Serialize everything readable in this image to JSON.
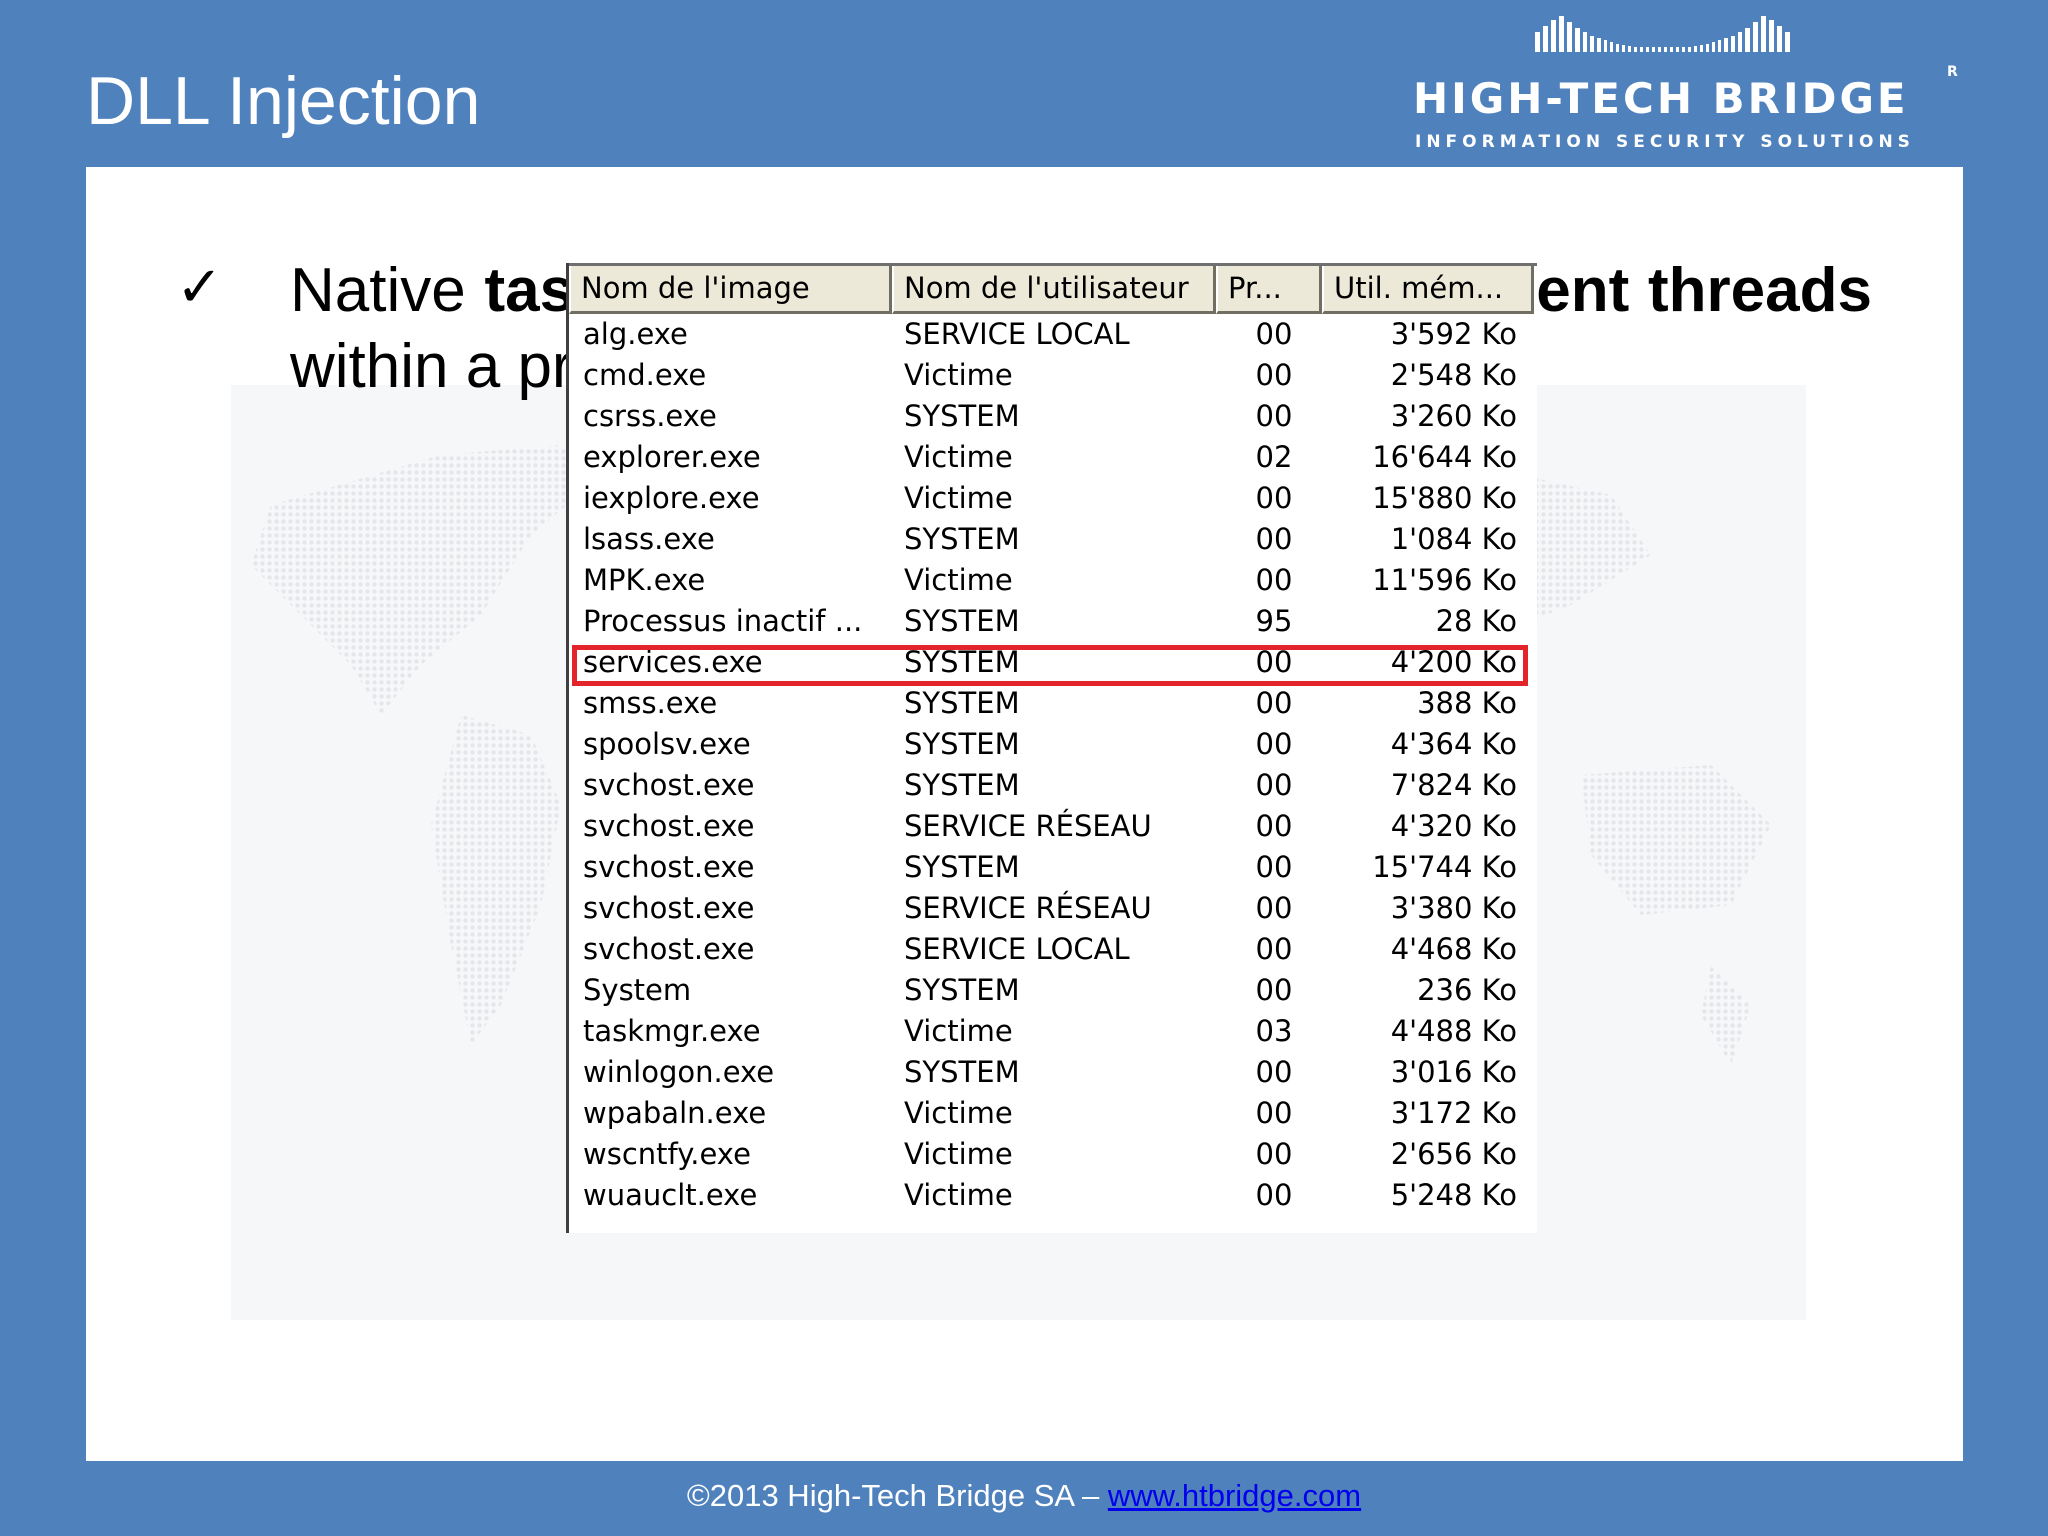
{
  "slide": {
    "title": "DLL Injection"
  },
  "logo": {
    "name": "HIGH-TECH BRIDGE",
    "tagline": "INFORMATION SECURITY SOLUTIONS",
    "registered_mark": "R"
  },
  "bullet": {
    "check_icon": "✓",
    "text_parts": {
      "p1": "Native ",
      "b1": "task manager does not display current threads",
      "p2": " within a process."
    }
  },
  "task_manager": {
    "columns": [
      {
        "label": "Nom de l'image"
      },
      {
        "label": "Nom de l'utilisateur"
      },
      {
        "label": "Pr..."
      },
      {
        "label": "Util. mém..."
      }
    ],
    "rows": [
      {
        "image": "alg.exe",
        "user": "SERVICE LOCAL",
        "cpu": "00",
        "mem": "3'592 Ko"
      },
      {
        "image": "cmd.exe",
        "user": "Victime",
        "cpu": "00",
        "mem": "2'548 Ko"
      },
      {
        "image": "csrss.exe",
        "user": "SYSTEM",
        "cpu": "00",
        "mem": "3'260 Ko"
      },
      {
        "image": "explorer.exe",
        "user": "Victime",
        "cpu": "02",
        "mem": "16'644 Ko"
      },
      {
        "image": "iexplore.exe",
        "user": "Victime",
        "cpu": "00",
        "mem": "15'880 Ko"
      },
      {
        "image": "lsass.exe",
        "user": "SYSTEM",
        "cpu": "00",
        "mem": "1'084 Ko"
      },
      {
        "image": "MPK.exe",
        "user": "Victime",
        "cpu": "00",
        "mem": "11'596 Ko"
      },
      {
        "image": "Processus inactif ...",
        "user": "SYSTEM",
        "cpu": "95",
        "mem": "28 Ko"
      },
      {
        "image": "services.exe",
        "user": "SYSTEM",
        "cpu": "00",
        "mem": "4'200 Ko"
      },
      {
        "image": "smss.exe",
        "user": "SYSTEM",
        "cpu": "00",
        "mem": "388 Ko"
      },
      {
        "image": "spoolsv.exe",
        "user": "SYSTEM",
        "cpu": "00",
        "mem": "4'364 Ko"
      },
      {
        "image": "svchost.exe",
        "user": "SYSTEM",
        "cpu": "00",
        "mem": "7'824 Ko"
      },
      {
        "image": "svchost.exe",
        "user": "SERVICE RÉSEAU",
        "cpu": "00",
        "mem": "4'320 Ko"
      },
      {
        "image": "svchost.exe",
        "user": "SYSTEM",
        "cpu": "00",
        "mem": "15'744 Ko"
      },
      {
        "image": "svchost.exe",
        "user": "SERVICE RÉSEAU",
        "cpu": "00",
        "mem": "3'380 Ko"
      },
      {
        "image": "svchost.exe",
        "user": "SERVICE LOCAL",
        "cpu": "00",
        "mem": "4'468 Ko"
      },
      {
        "image": "System",
        "user": "SYSTEM",
        "cpu": "00",
        "mem": "236 Ko"
      },
      {
        "image": "taskmgr.exe",
        "user": "Victime",
        "cpu": "03",
        "mem": "4'488 Ko"
      },
      {
        "image": "winlogon.exe",
        "user": "SYSTEM",
        "cpu": "00",
        "mem": "3'016 Ko"
      },
      {
        "image": "wpabaln.exe",
        "user": "Victime",
        "cpu": "00",
        "mem": "3'172 Ko"
      },
      {
        "image": "wscntfy.exe",
        "user": "Victime",
        "cpu": "00",
        "mem": "2'656 Ko"
      },
      {
        "image": "wuauclt.exe",
        "user": "Victime",
        "cpu": "00",
        "mem": "5'248 Ko"
      }
    ],
    "highlighted_row": "iexplore.exe",
    "highlight_color": "#e3242b"
  },
  "footer": {
    "copyright": "©2013 High-Tech Bridge SA – ",
    "link_text": "www.htbridge.com"
  },
  "colors": {
    "background": "#4f81bd",
    "panel": "#ffffff"
  }
}
